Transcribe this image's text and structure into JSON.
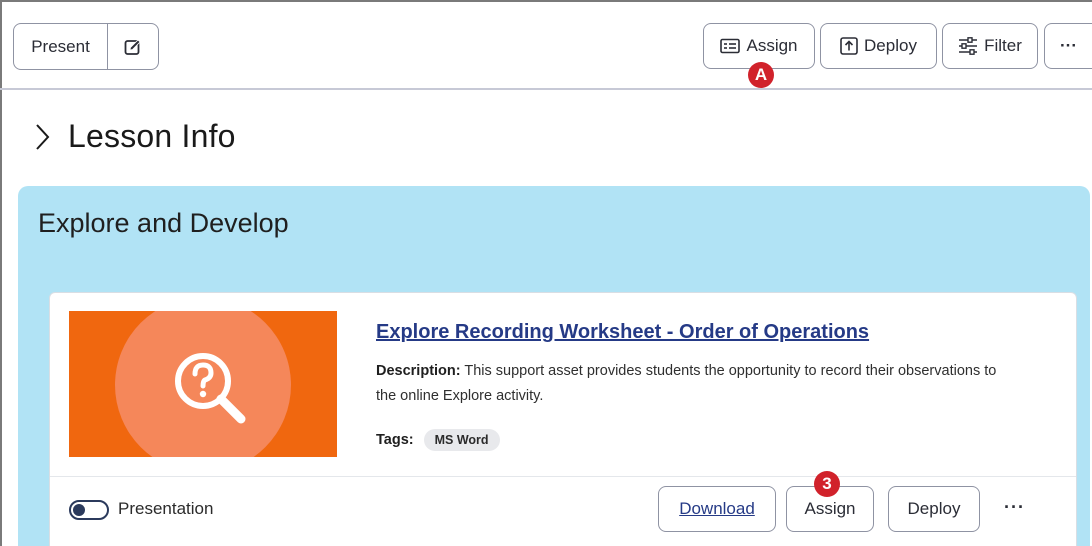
{
  "toolbar": {
    "present_label": "Present",
    "assign_label": "Assign",
    "deploy_label": "Deploy",
    "filter_label": "Filter",
    "more_label": "···",
    "assign_badge": "A"
  },
  "lesson": {
    "title": "Lesson Info"
  },
  "section": {
    "title": "Explore and Develop",
    "background": "#b1e3f5"
  },
  "card": {
    "title": "Explore Recording Worksheet - Order of Operations",
    "description_label": "Description:",
    "description_text": " This support asset provides students the opportunity to record their observations to the online Explore activity.",
    "tags_label": "Tags:",
    "tag": "MS Word",
    "thumbnail_icon": "search-question-icon",
    "thumbnail_color": "#f0670f",
    "toggle_label": "Presentation",
    "download_label": "Download",
    "assign_label": "Assign",
    "deploy_label": "Deploy",
    "more_label": "···",
    "assign_badge": "3"
  },
  "colors": {
    "badge": "#d1222b",
    "link": "#253a86"
  }
}
